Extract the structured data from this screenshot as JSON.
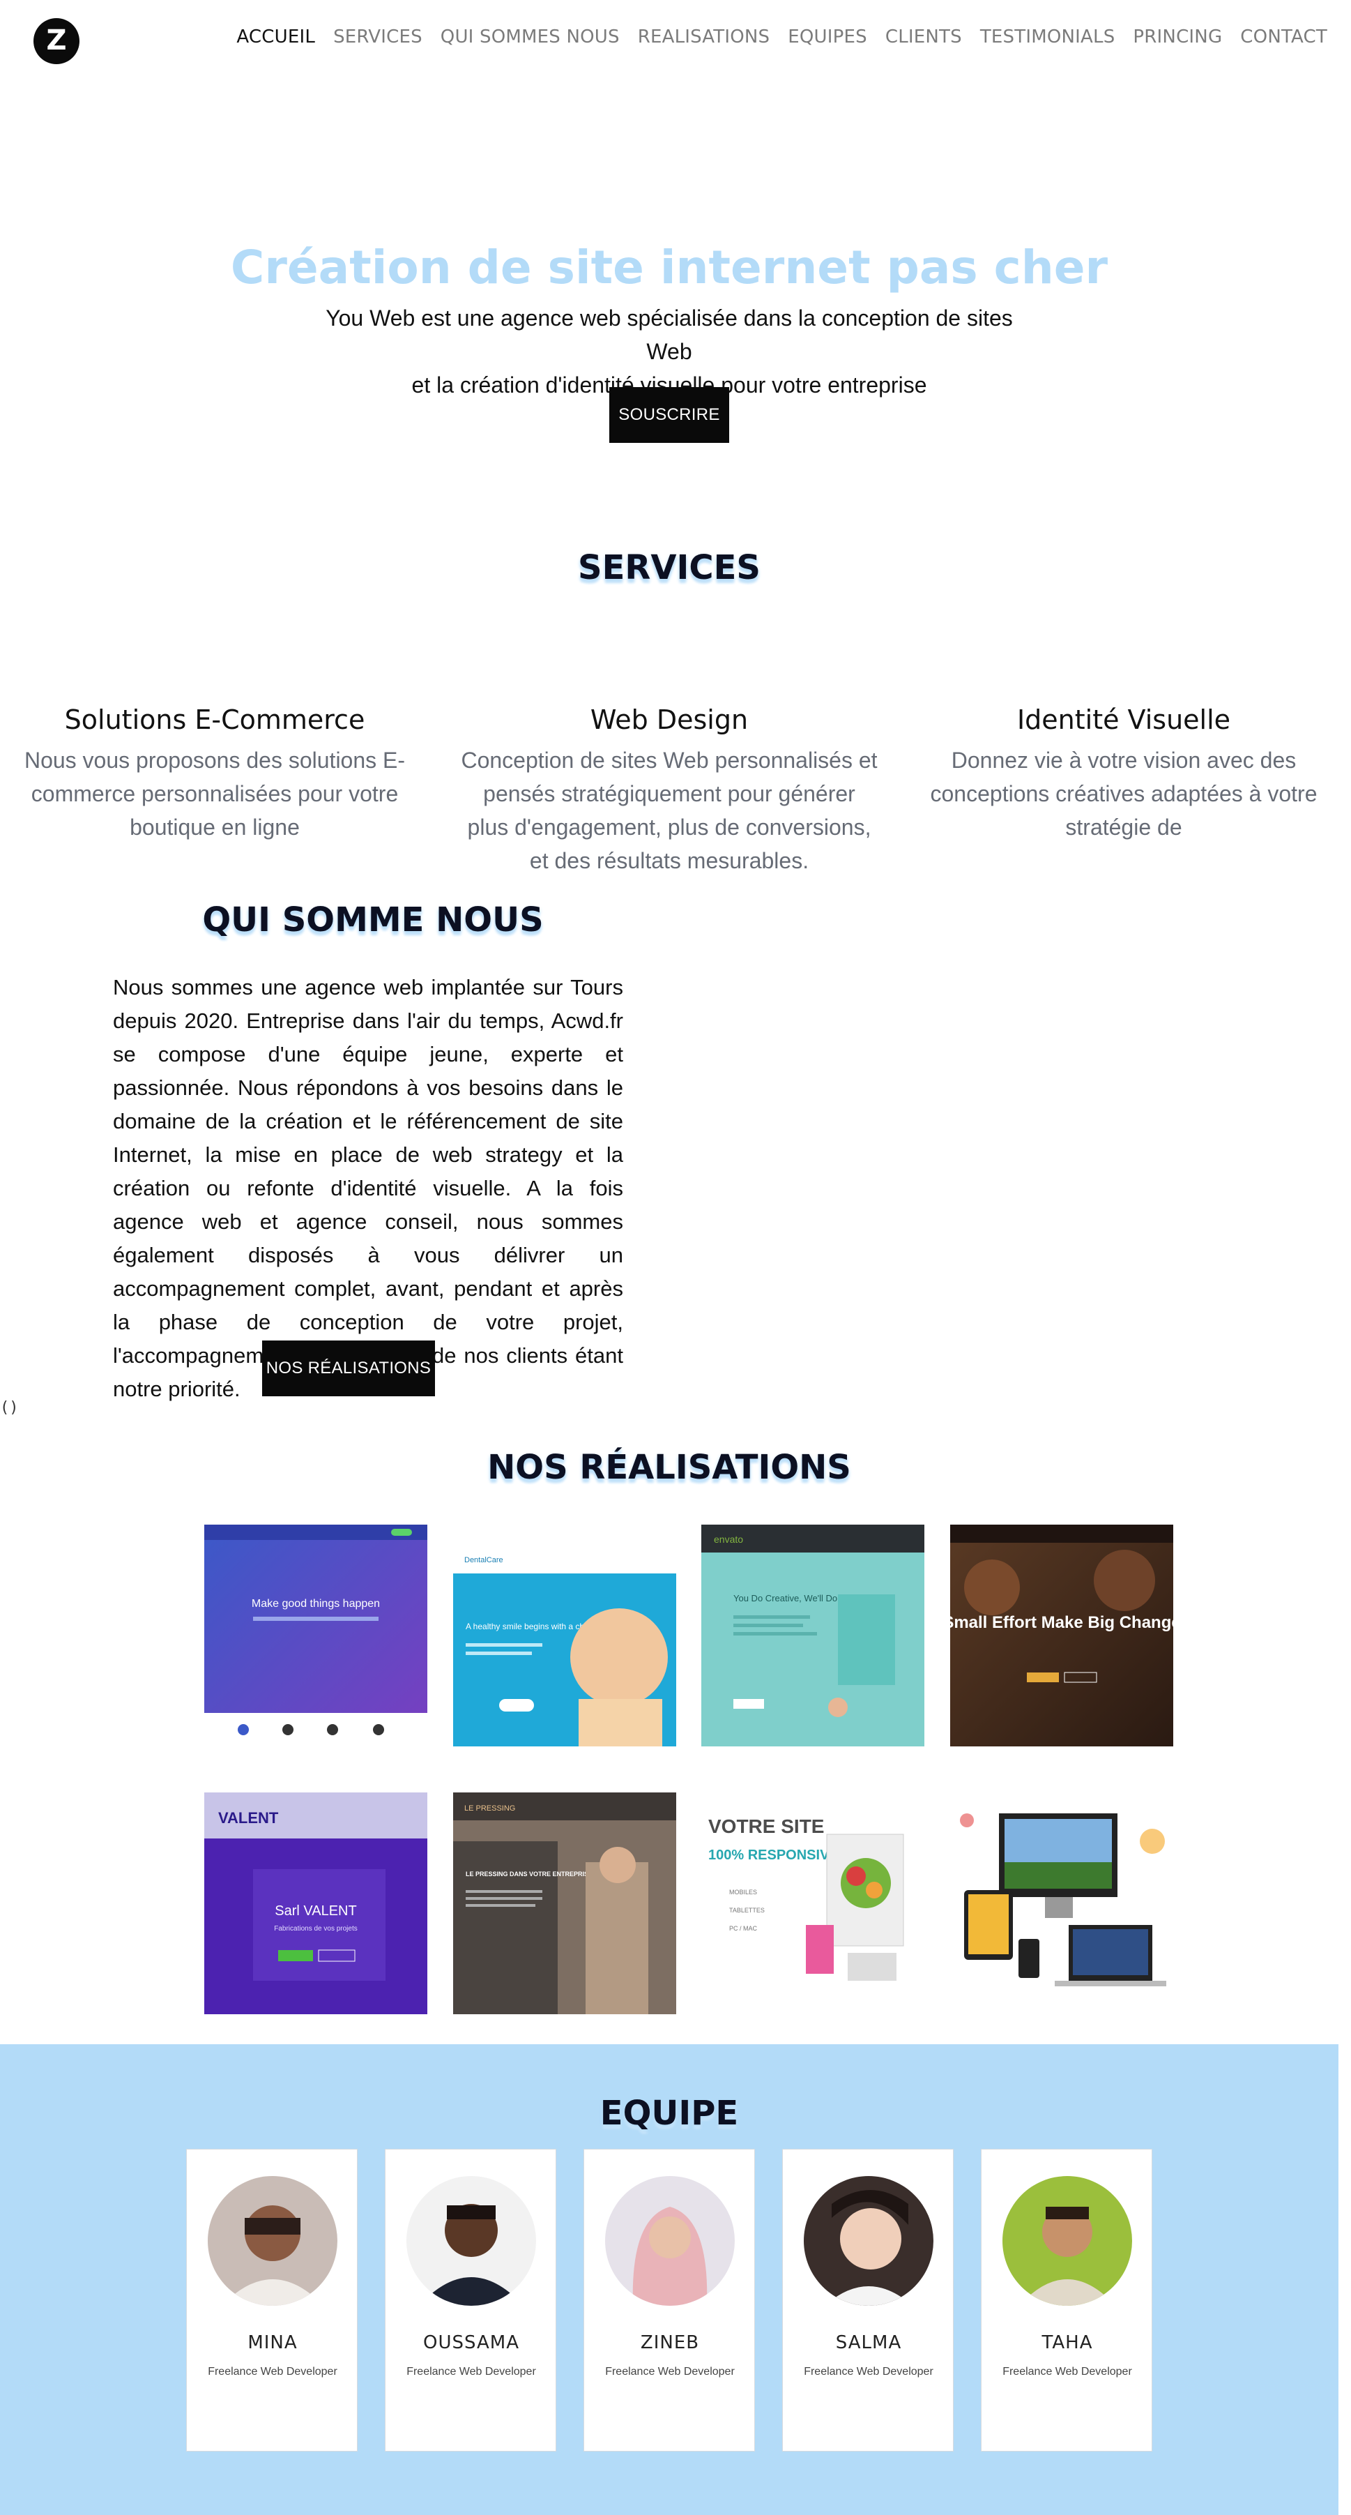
{
  "nav": {
    "logo_icon": "z-logo-icon",
    "items": [
      "ACCUEIL",
      "SERVICES",
      "QUI SOMMES NOUS",
      "REALISATIONS",
      "EQUIPES",
      "CLIENTS",
      "TESTIMONIALS",
      "PRINCING",
      "CONTACT"
    ],
    "active": "ACCUEIL"
  },
  "hero": {
    "title": "Création de site internet pas cher",
    "line1": "You Web est une agence web spécialisée dans la conception de sites Web",
    "line2": "et la création d'identité visuelle pour votre entreprise",
    "button": "SOUSCRIRE"
  },
  "services": {
    "title": "SERVICES",
    "items": [
      {
        "title": "Solutions E-Commerce",
        "text": "Nous vous proposons des solutions E-commerce personnalisées pour votre boutique en ligne"
      },
      {
        "title": "Web Design",
        "text": "Conception de sites Web personnalisés et pensés stratégiquement pour générer plus d'engagement, plus de conversions, et des résultats mesurables."
      },
      {
        "title": "Identité Visuelle",
        "text": "Donnez vie à votre vision avec des conceptions créatives adaptées à votre stratégie de"
      }
    ]
  },
  "about": {
    "title": "QUI SOMME NOUS",
    "text": "Nous sommes une agence web implantée sur Tours depuis 2020. Entreprise dans l'air du temps, Acwd.fr se compose d'une équipe jeune, experte et passionnée. Nous répondons à vos besoins dans le domaine de la création et le référencement de site Internet, la mise en place de web strategy et la création ou refonte d'identité visuelle. A la fois agence web et agence conseil, nous sommes également disposés à vous délivrer un accompagnement complet, avant, pendant et après la phase de conception de votre projet, l'accompagnement à long terme de nos clients étant notre priorité.",
    "button": "NOS RÉALISATIONS",
    "stray": "()"
  },
  "realisations": {
    "title": "NOS RÉALISATIONS",
    "shots": [
      {
        "headline": "Make good things happen"
      },
      {
        "brand": "DentalCare",
        "headline": "A healthy smile begins with a child"
      },
      {
        "brand": "envato",
        "headline": "You Do Creative, We'll Do the Rest."
      },
      {
        "headline": "Small Effort Make Big Change"
      },
      {
        "brand": "VALENT",
        "headline": "Sarl VALENT",
        "sub": "Fabrications de vos projets"
      },
      {
        "brand": "LE PRESSING",
        "headline": "LE PRESSING DANS VOTRE ENTREPRISE"
      },
      {
        "headline": "VOTRE SITE",
        "sub": "100% RESPONSIVE",
        "tags": [
          "MOBILES",
          "TABLETTES",
          "PC / MAC"
        ]
      },
      {
        "headline": ""
      }
    ]
  },
  "team": {
    "title": "EQUIPE",
    "members": [
      {
        "name": "MINA",
        "role": "Freelance Web Developer",
        "avatar_color": "#c9bcb6"
      },
      {
        "name": "OUSSAMA",
        "role": "Freelance Web Developer",
        "avatar_color": "#f2f2f2"
      },
      {
        "name": "ZINEB",
        "role": "Freelance Web Developer",
        "avatar_color": "#e6e2ea"
      },
      {
        "name": "SALMA",
        "role": "Freelance Web Developer",
        "avatar_color": "#3a2e2b"
      },
      {
        "name": "TAHA",
        "role": "Freelance Web Developer",
        "avatar_color": "#9bbf3c"
      }
    ]
  },
  "colors": {
    "accent": "#b3dbf8",
    "dark_button": "#0a0a0a",
    "muted_text": "#666b75"
  }
}
